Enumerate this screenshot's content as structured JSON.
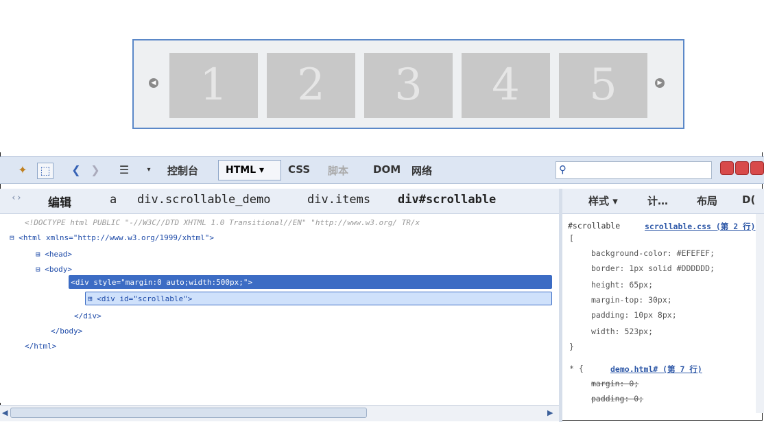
{
  "demo": {
    "prev_arrow": "◀",
    "next_arrow": "▶",
    "items": [
      "1",
      "2",
      "3",
      "4",
      "5"
    ]
  },
  "toolbar": {
    "tabs": [
      "控制台",
      "HTML ▾",
      "CSS",
      "脚本",
      "DOM",
      "网络"
    ]
  },
  "breadcrumb": {
    "edit": "编辑",
    "items": [
      "a",
      "div.scrollable_demo",
      "div.items",
      "div#scrollable"
    ]
  },
  "side_tabs": [
    "样式 ▾",
    "计…",
    "布局",
    "D("
  ],
  "html_tree": [
    "<!DOCTYPE html PUBLIC \"-//W3C//DTD XHTML 1.0 Transitional//EN\" \"http://www.w3.org/ TR/x",
    "⊟ <html xmlns=\"http://www.w3.org/1999/xhtml\">",
    "⊞ <head>",
    "⊟ <body>",
    "⊟ <div style=\"margin:0 auto;width:500px;\">",
    "⊞ <div id=\"scrollable\">",
    "</div>",
    "</body>",
    "</html>"
  ],
  "css_rules": {
    "selector": "#scrollable",
    "source": "scrollable.css (第 2 行)",
    "props": [
      "background-color: #EFEFEF;",
      "border: 1px solid #DDDDDD;",
      "height: 65px;",
      "margin-top: 30px;",
      "padding: 10px 8px;",
      "width: 523px;"
    ],
    "rule2_selector": "* {",
    "rule2_source": "demo.html# (第 7 行)",
    "rule2_props": [
      "margin: 0;",
      "padding: 0;"
    ]
  },
  "colors": {
    "accent": "#3c6cc4",
    "devtools_bg": "#dde6f3",
    "item_gray": "#c8c8c8"
  }
}
